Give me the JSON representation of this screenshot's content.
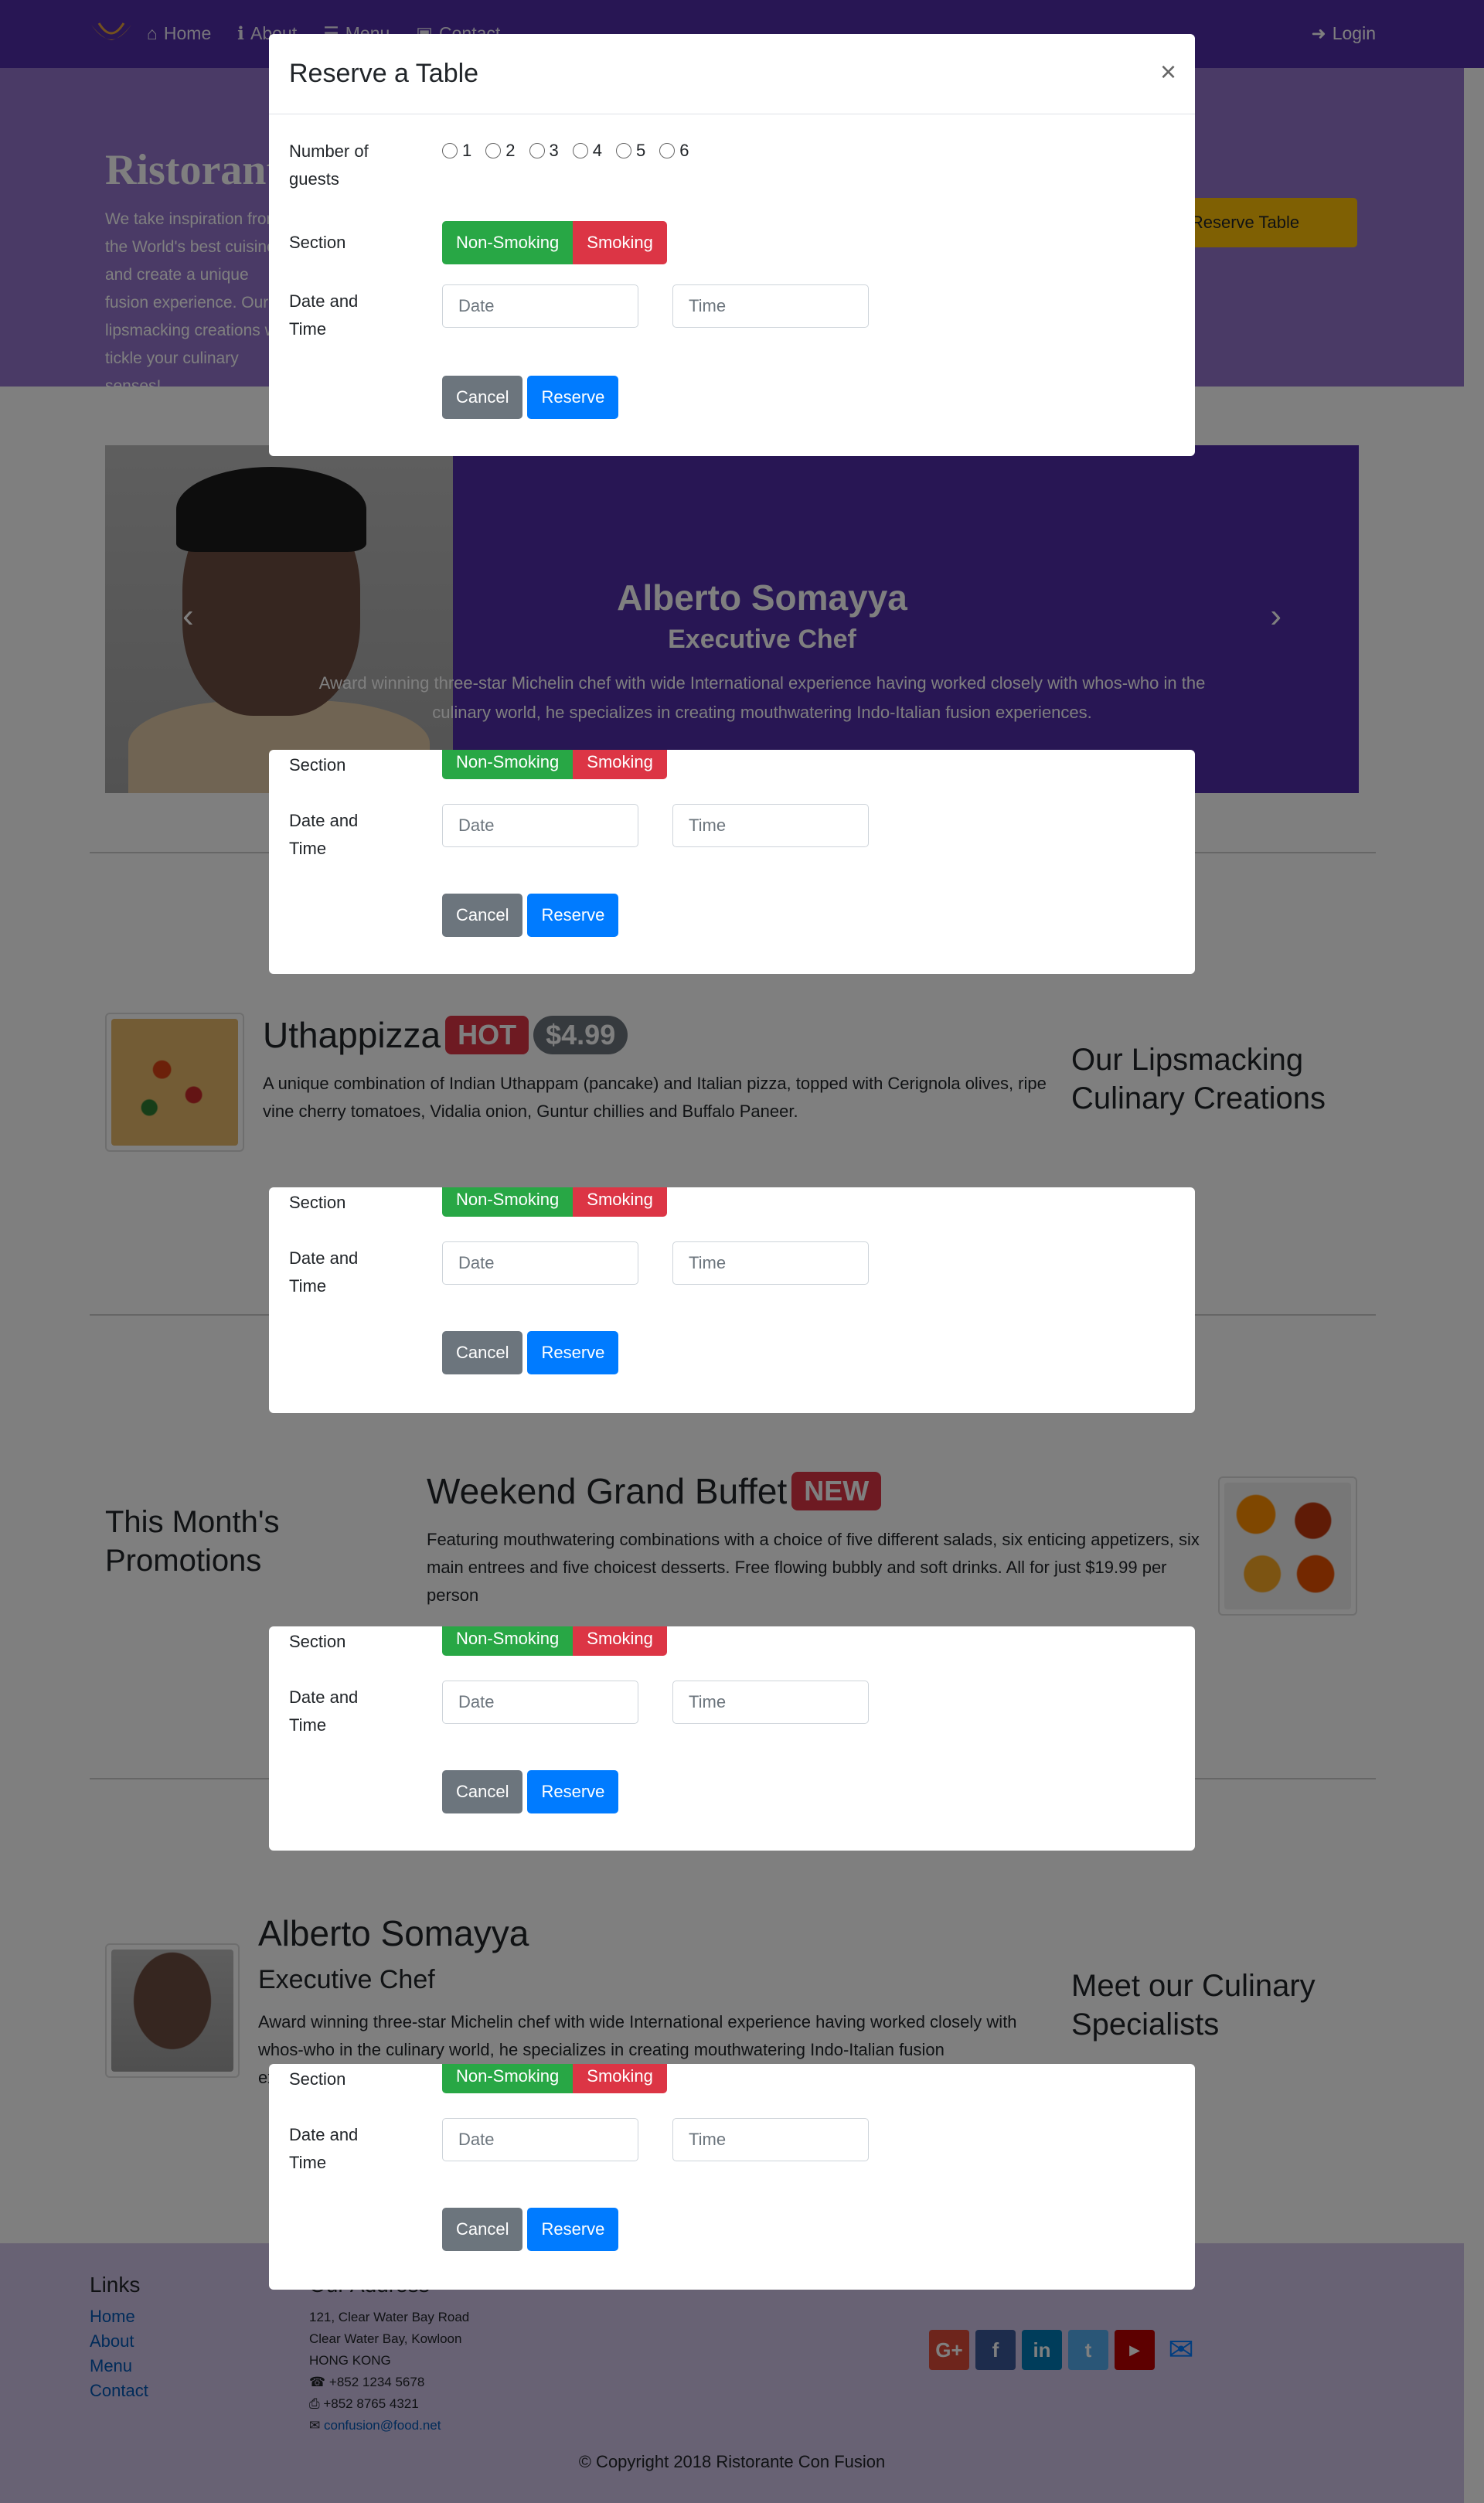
{
  "navbar": {
    "items": [
      {
        "label": "Home",
        "icon": "home-icon"
      },
      {
        "label": "About",
        "icon": "info-icon"
      },
      {
        "label": "Menu",
        "icon": "list-icon"
      },
      {
        "label": "Contact",
        "icon": "address-card-icon"
      }
    ],
    "login": "Login"
  },
  "jumbotron": {
    "title": "Ristorante con Fusion",
    "text": "We take inspiration from the World's best cuisines, and create a unique fusion experience. Our lipsmacking creations will tickle your culinary senses!",
    "reserve_button": "Reserve Table"
  },
  "carousel": {
    "name": "Alberto Somayya",
    "role": "Executive Chef",
    "text": "Award winning three-star Michelin chef with wide International experience having worked closely with whos-who in the culinary world, he specializes in creating mouthwatering Indo-Italian fusion experiences."
  },
  "dish": {
    "name": "Uthappizza",
    "badge": "HOT",
    "price": "$4.99",
    "description": "A unique combination of Indian Uthappam (pancake) and Italian pizza, topped with Cerignola olives, ripe vine cherry tomatoes, Vidalia onion, Guntur chillies and Buffalo Paneer.",
    "side_heading": "Our Lipsmacking Culinary Creations"
  },
  "promotion": {
    "name": "Weekend Grand Buffet",
    "badge": "NEW",
    "description": "Featuring mouthwatering combinations with a choice of five different salads, six enticing appetizers, six main entrees and five choicest desserts. Free flowing bubbly and soft drinks. All for just $19.99 per person",
    "side_heading": "This Month's Promotions"
  },
  "leader": {
    "name": "Alberto Somayya",
    "role": "Executive Chef",
    "description": "Award winning three-star Michelin chef with wide International experience having worked closely with whos-who in the culinary world, he specializes in creating mouthwatering Indo-Italian fusion experiences.",
    "side_heading": "Meet our Culinary Specialists"
  },
  "footer": {
    "links_title": "Links",
    "links": [
      "Home",
      "About",
      "Menu",
      "Contact"
    ],
    "address_title": "Our Address",
    "address_lines": [
      "121, Clear Water Bay Road",
      "Clear Water Bay, Kowloon",
      "HONG KONG"
    ],
    "phone": "+852 1234 5678",
    "fax": "+852 8765 4321",
    "email": "confusion@food.net",
    "copyright": "© Copyright 2018 Ristorante Con Fusion"
  },
  "modal": {
    "title": "Reserve a Table",
    "close": "×",
    "guests_label": "Number of guests",
    "guest_options": [
      "1",
      "2",
      "3",
      "4",
      "5",
      "6"
    ],
    "section_label": "Section",
    "non_smoking": "Non-Smoking",
    "smoking": "Smoking",
    "datetime_label": "Date and Time",
    "date_placeholder": "Date",
    "time_placeholder": "Time",
    "cancel": "Cancel",
    "reserve": "Reserve"
  },
  "colors": {
    "primary": "#512da8",
    "light": "#9575cd",
    "footer": "#d1c4e9",
    "accent": "#ffc107"
  }
}
